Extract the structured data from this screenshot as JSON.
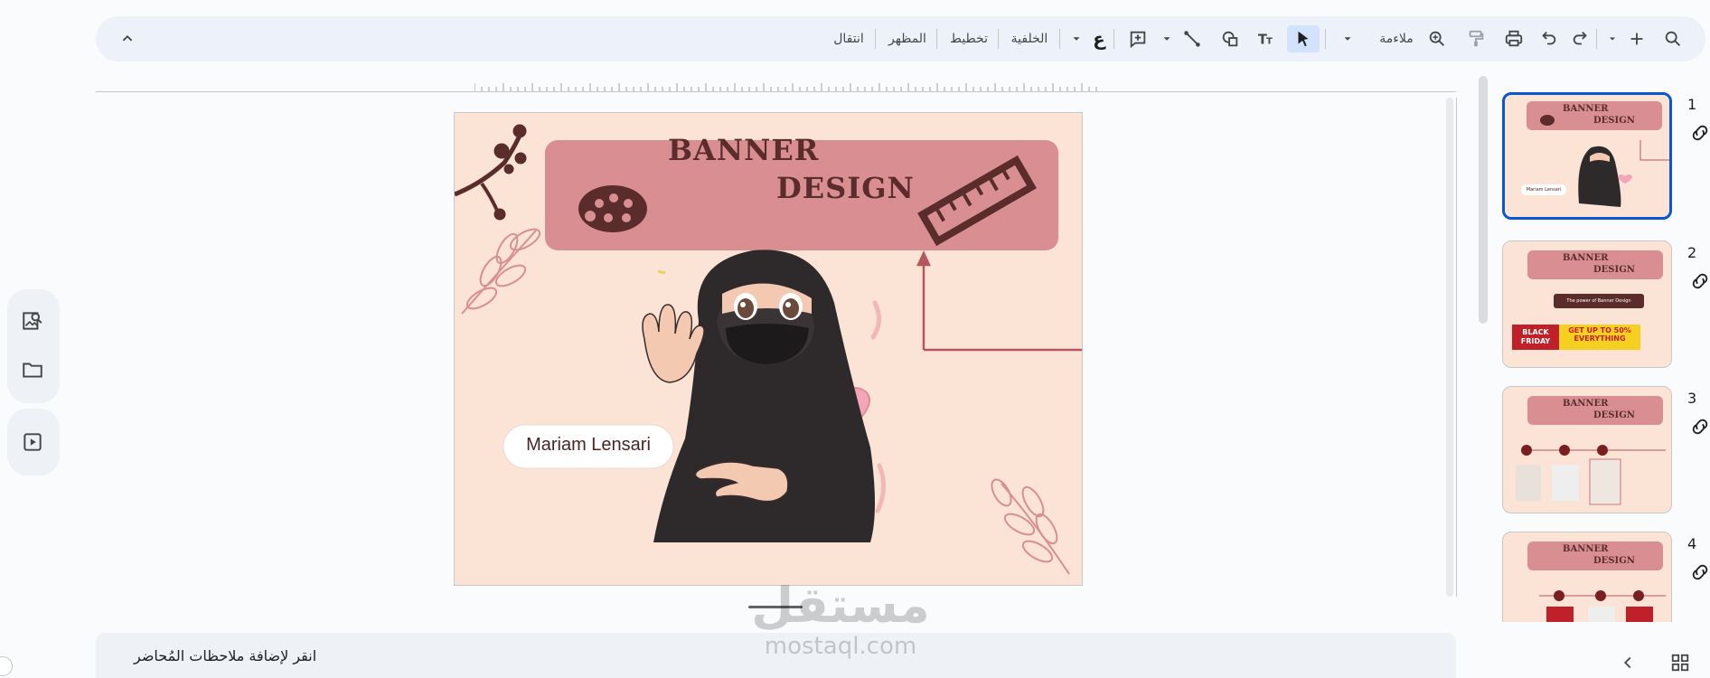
{
  "toolbar": {
    "search_icon": "search-icon",
    "add_icon": "plus-icon",
    "redo_icon": "redo-icon",
    "undo_icon": "undo-icon",
    "print_icon": "print-icon",
    "paint_format_icon": "paint-format-icon",
    "zoom_icon": "zoom-icon",
    "zoom_label": "ملاءمة",
    "select_icon": "cursor-icon",
    "text_icon": "text-box-icon",
    "shape_icon": "shape-icon",
    "line_icon": "line-icon",
    "comment_icon": "add-comment-icon",
    "input_tools_label": "ع",
    "background_label": "الخلفية",
    "layout_label": "تخطيط",
    "theme_label": "المظهر",
    "transition_label": "انتقال",
    "collapse_icon": "chevron-up-icon"
  },
  "slide": {
    "banner_line1": "BANNER",
    "banner_line2": "DESIGN",
    "name": "Mariam Lensari",
    "colors": {
      "background": "#fbe3d6",
      "banner": "#d98f92",
      "ink": "#5a2c2c",
      "accent": "#b5585c"
    }
  },
  "left_panel": {
    "icons": [
      "image-search-icon",
      "folder-icon",
      "slideshow-icon"
    ]
  },
  "filmstrip": {
    "slides": [
      {
        "number": "1",
        "title1": "BANNER",
        "title2": "DESIGN",
        "name": "Mariam Lensari"
      },
      {
        "number": "2",
        "title1": "BANNER",
        "title2": "DESIGN",
        "caption": "The power of Banner Design",
        "promo_left": "BLACK FRIDAY",
        "promo_right": "GET UP TO 50% EVERYTHING"
      },
      {
        "number": "3",
        "title1": "BANNER",
        "title2": "DESIGN"
      },
      {
        "number": "4",
        "title1": "BANNER",
        "title2": "DESIGN"
      }
    ]
  },
  "notes": {
    "placeholder": "انقر لإضافة ملاحظات المُحاضر"
  },
  "watermark": {
    "arabic": "مستقل",
    "latin": "mostaql.com"
  },
  "bottom": {
    "grid_icon": "grid-view-icon",
    "chevron_icon": "chevron-left-icon"
  }
}
